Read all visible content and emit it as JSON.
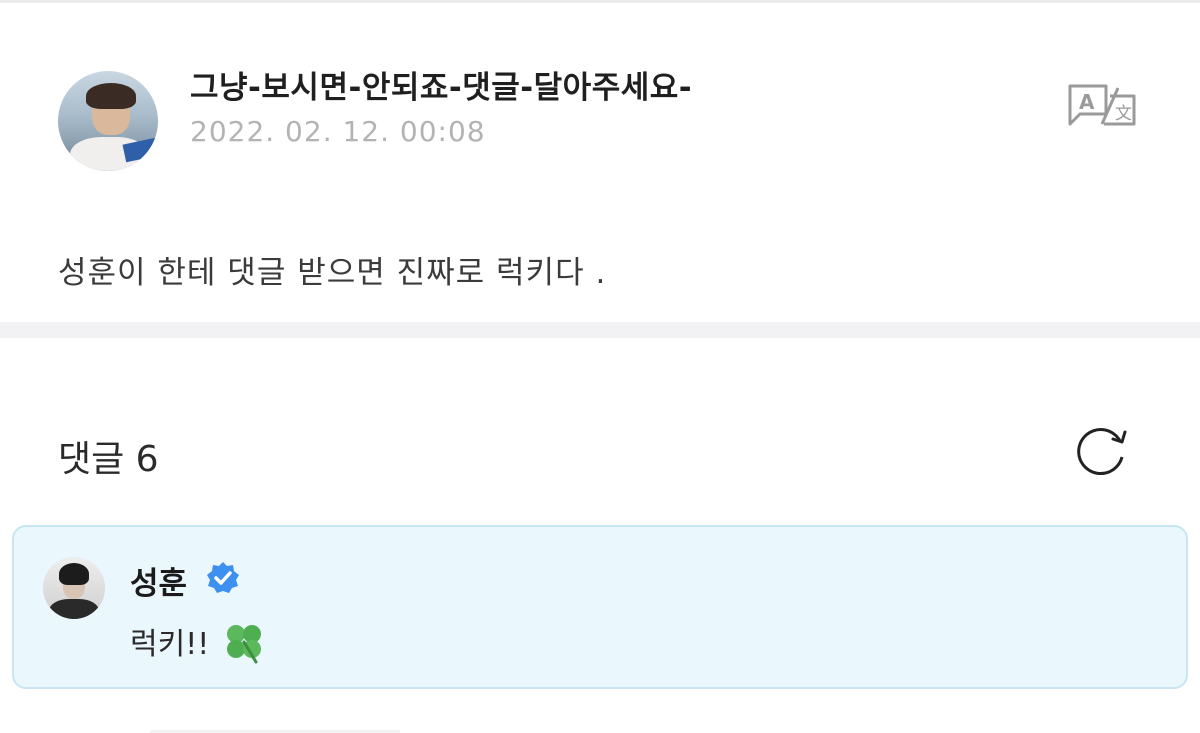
{
  "post": {
    "title": "그냥-보시면-안되죠-댓글-달아주세요-",
    "date": "2022. 02. 12. 00:08",
    "body": "성훈이 한테 댓글 받으면 진짜로 럭키다 .",
    "translate_icon": "translate-icon"
  },
  "comments": {
    "label": "댓글 6",
    "refresh_icon": "refresh-icon",
    "items": [
      {
        "author": "성훈",
        "verified_icon": "verified-badge-icon",
        "text": "럭키!!",
        "emoji_icon": "four-leaf-clover-icon"
      }
    ]
  },
  "colors": {
    "comment_bg": "#eaf7fd",
    "comment_border": "#c8e6f2",
    "verified_blue": "#3d8ff0",
    "date_gray": "#b3b3b3",
    "clover_green": "#5cb85c"
  }
}
